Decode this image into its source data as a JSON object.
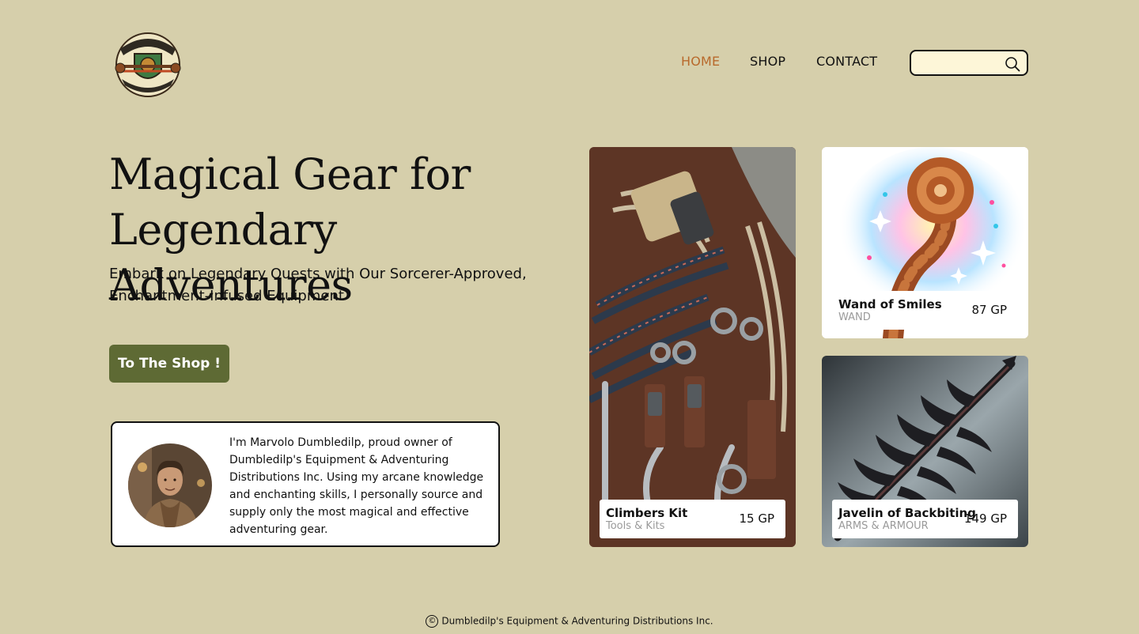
{
  "header": {
    "logo_text": "DUMBLEDILP'S EQUIPMENT & ADVENTURING DISTRIBUTIONS INC.",
    "nav": [
      {
        "label": "HOME",
        "active": true
      },
      {
        "label": "SHOP",
        "active": false
      },
      {
        "label": "CONTACT",
        "active": false
      }
    ],
    "search": {
      "value": "",
      "placeholder": "",
      "icon": "search-icon"
    }
  },
  "hero": {
    "title_line1": "Magical Gear for",
    "title_line2": "Legendary Adventures",
    "subtitle": "Embark on Legendary Quests with Our Sorcerer-Approved, Enchantment-Infused Equipment",
    "cta_label": "To The Shop !"
  },
  "owner": {
    "bio": "I'm Marvolo Dumbledilp, proud owner of Dumbledilp's Equipment & Adventuring Distributions Inc. Using my arcane knowledge and enchanting skills, I personally source and supply only the most magical and effective adventuring gear."
  },
  "products": [
    {
      "name": "Climbers Kit",
      "category": "Tools & Kits",
      "price": "15 GP"
    },
    {
      "name": "Wand of Smiles",
      "category": "WAND",
      "price": "87 GP"
    },
    {
      "name": "Javelin of Backbiting",
      "category": "ARMS & ARMOUR",
      "price": "149 GP"
    }
  ],
  "footer": {
    "copyright_symbol": "©",
    "text": "Dumbledilp's Equipment & Adventuring Distributions Inc."
  },
  "colors": {
    "background": "#d6cfab",
    "accent_nav": "#b8692b",
    "button": "#5e6a34",
    "search_bg": "#fdf6d8"
  }
}
